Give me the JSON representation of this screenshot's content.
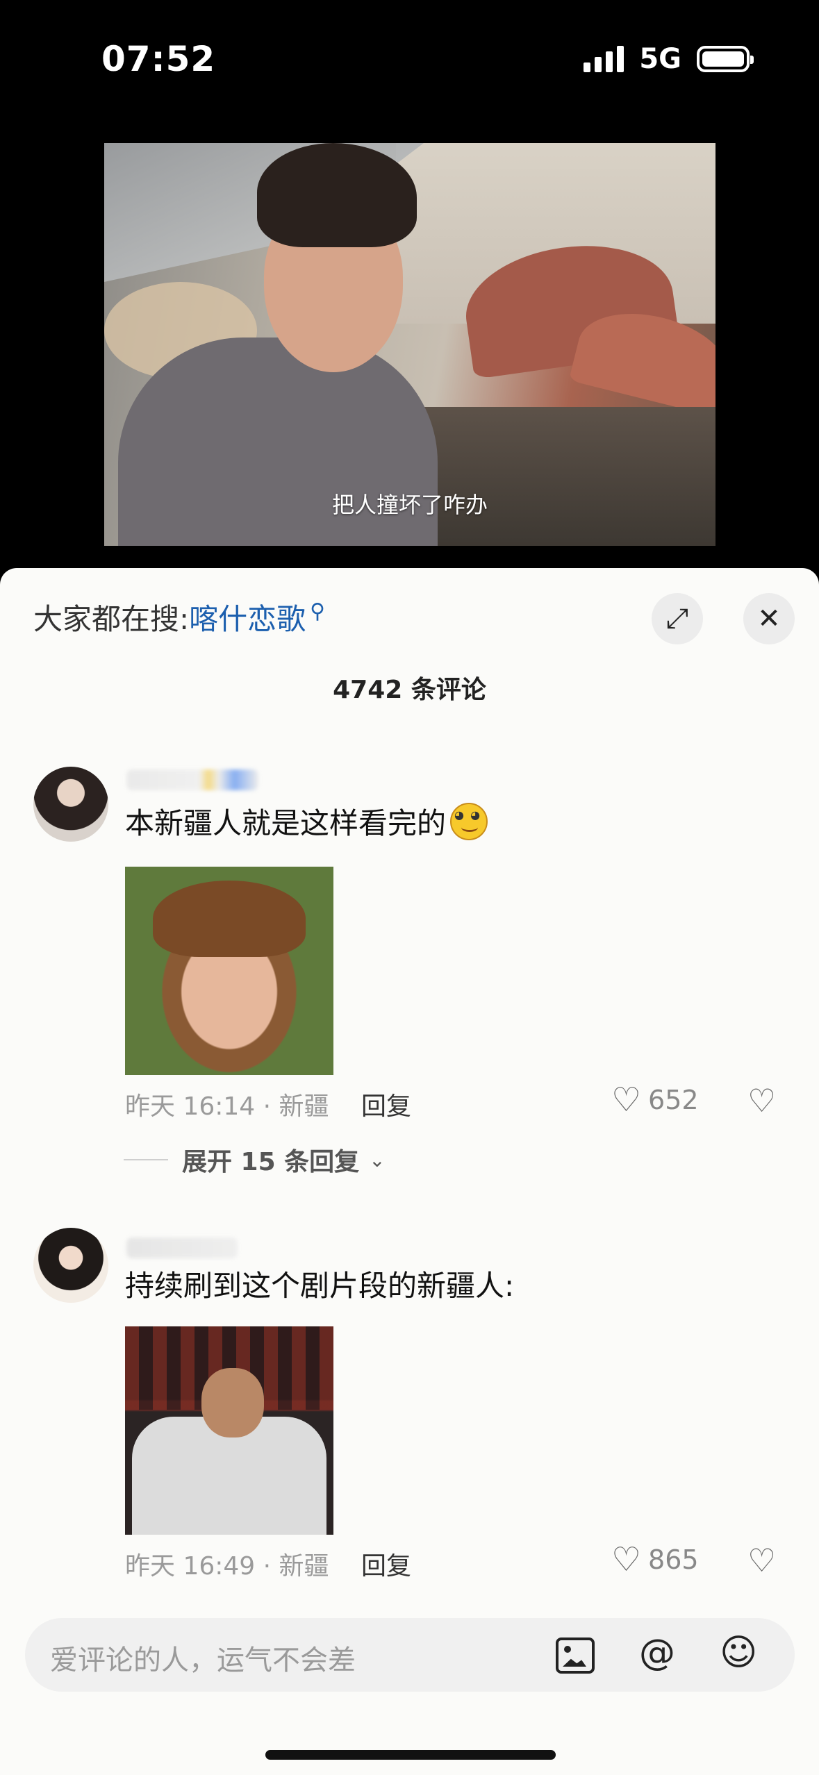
{
  "status_bar": {
    "time": "07:52",
    "network": "5G"
  },
  "video": {
    "subtitle": "把人撞坏了咋办"
  },
  "header": {
    "search_prefix": "大家都在搜:",
    "search_term": "喀什恋歌",
    "comment_count": "4742 条评论"
  },
  "comments": [
    {
      "text": "本新疆人就是这样看完的",
      "meta": "昨天 16:14 · 新疆",
      "reply": "回复",
      "likes": "652",
      "expand": "展开 15 条回复"
    },
    {
      "text": "持续刷到这个剧片段的新疆人:",
      "meta": "昨天 16:49 · 新疆",
      "reply": "回复",
      "likes": "865"
    }
  ],
  "input": {
    "placeholder": "爱评论的人，运气不会差"
  },
  "icons": {
    "search": "magnifier-icon",
    "expand": "expand-icon",
    "close": "close-icon",
    "like": "heart-icon",
    "dislike": "broken-heart-icon",
    "image": "image-icon",
    "mention": "at-icon",
    "emoji": "smile-icon"
  },
  "colors": {
    "link": "#1c5fae",
    "sheet_bg": "#fbfbf9"
  }
}
